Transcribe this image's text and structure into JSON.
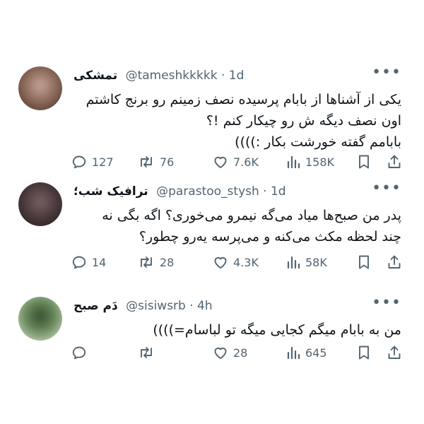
{
  "tweets": [
    {
      "name": "تمشکی",
      "handle": "@tameshkkkkk · 1d",
      "lines": [
        "یکی از آشناها از بابام پرسیده نصف زمینم رو برنج کاشتم",
        "اون نصف دیگه ش رو چیکار کنم !؟",
        "بابامم گفته خورشت بکار :))))"
      ],
      "replies": "127",
      "retweets": "76",
      "likes": "7.6K",
      "views": "158K",
      "avatar_colors": [
        "#3b2a24",
        "#8c6a5a",
        "#c9a79a"
      ]
    },
    {
      "name": "ترافیک شب؛",
      "handle": "@parastoo_stysh · 1d",
      "lines": [
        "پدر من صبح‌ها میاد می‌گه نیمرو می‌خوری؟ اگه بگی نه",
        "چند لحظه مکث می‌کنه و می‌پرسه یه‌رو چطور؟"
      ],
      "replies": "14",
      "retweets": "28",
      "likes": "4.3K",
      "views": "58K",
      "avatar_colors": [
        "#1e1718",
        "#4b3a3b",
        "#7a6468"
      ]
    },
    {
      "name": "دَم صبح",
      "handle": "@sisiwsrb · 4h",
      "lines": [
        "من به بابام میگم کجایی میگه تو لباسام=))))"
      ],
      "replies": "",
      "retweets": "",
      "likes": "28",
      "views": "645",
      "avatar_colors": [
        "#e8efe0",
        "#6f8f62",
        "#2f4b2a"
      ]
    }
  ],
  "colors": {
    "text": "#0f1419",
    "secondary": "#536471",
    "background": "#ffffff"
  },
  "icons": [
    "reply-icon",
    "retweet-icon",
    "like-icon",
    "views-icon",
    "bookmark-icon",
    "share-icon",
    "more-icon"
  ]
}
